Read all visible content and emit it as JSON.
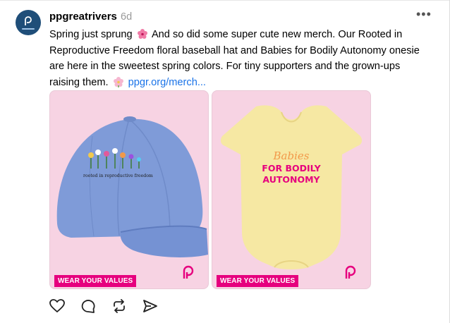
{
  "post": {
    "username": "ppgreatrivers",
    "timestamp": "6d",
    "caption_line1_a": "Spring just sprung",
    "caption_line1_b": "And so did some super cute new merch. Our Rooted in",
    "caption_line2": "Reproductive Freedom floral baseball hat and Babies for Bodily Autonomy onesie",
    "caption_line3": "are here in the sweetest spring colors. For tiny supporters and the grown-ups",
    "caption_line4_a": "raising them.",
    "link": "ppgr.org/merch..."
  },
  "images": [
    {
      "badge": "WEAR YOUR VALUES",
      "hat_text": "rooted in reproductive freedom"
    },
    {
      "badge": "WEAR YOUR VALUES",
      "onesie_script": "Babies",
      "onesie_line1": "FOR BODILY",
      "onesie_line2": "AUTONOMY"
    }
  ],
  "icons": {
    "more": "more-options-icon",
    "like": "heart-icon",
    "comment": "comment-icon",
    "repost": "repost-icon",
    "share": "send-icon"
  },
  "colors": {
    "card_bg": "#f7d3e3",
    "badge": "#e6007e",
    "hat": "#7f9bd8",
    "onesie": "#f6e8a3",
    "link": "#1a73e8"
  }
}
